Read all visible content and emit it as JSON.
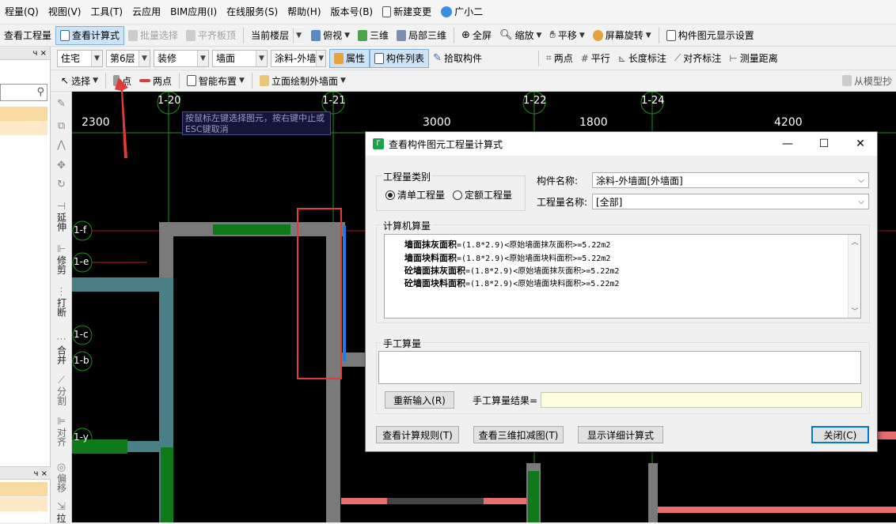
{
  "menubar": {
    "items": [
      "程量(Q)",
      "视图(V)",
      "工具(T)",
      "云应用",
      "BIM应用(I)",
      "在线服务(S)",
      "帮助(H)",
      "版本号(B)"
    ],
    "new_change": "新建变更",
    "assistant": "广小二"
  },
  "toolbar1": {
    "view_quantity": "查看工程量",
    "view_formula": "查看计算式",
    "batch_select": "批量选择",
    "align_slab": "平齐板顶",
    "current_floor": "当前楼层",
    "top_view": "俯视",
    "three_d": "三维",
    "local_3d": "局部三维",
    "fullscreen": "全屏",
    "zoom": "缩放",
    "pan": "平移",
    "rotate": "屏幕旋转",
    "display_settings": "构件图元显示设置"
  },
  "toolbar2": {
    "category": "住宅",
    "floor": "第6层",
    "type": "装修",
    "subtype": "墙面",
    "component": "涂料-外墙",
    "properties": "属性",
    "component_list": "构件列表",
    "pick_component": "拾取构件",
    "two_points": "两点",
    "parallel": "平行",
    "length_dim": "长度标注",
    "aligned_dim": "对齐标注",
    "measure": "测量距离"
  },
  "toolbar3": {
    "select": "选择",
    "point": "点",
    "two_points": "两点",
    "smart_layout": "智能布置",
    "elevation_draw": "立面绘制外墙面",
    "from_model": "从模型抄"
  },
  "left_panel": {
    "pin": "ч ×",
    "pin2": "ч ×"
  },
  "vertical_tools": {
    "extend": "延伸",
    "trim": "修剪",
    "break": "打断",
    "merge": "合并",
    "split": "分割",
    "align": "对齐",
    "offset": "偏移",
    "stretch": "拉"
  },
  "canvas": {
    "tooltip": "按鼠标左键选择图元，按右键中止或ESC键取消",
    "axes_top": [
      "1-20",
      "1-21",
      "1-22",
      "1-24"
    ],
    "dimensions": [
      "2300",
      "3000",
      "1800",
      "4200"
    ],
    "axes_left": [
      "1-f",
      "1-e",
      "1-c",
      "1-b",
      "1-y"
    ]
  },
  "dialog": {
    "title": "查看构件图元工程量计算式",
    "minimize": "—",
    "maximize": "☐",
    "close": "✕",
    "quantity_type_label": "工程量类别",
    "radio_list": "清单工程量",
    "radio_quota": "定额工程量",
    "component_name_label": "构件名称:",
    "component_name_value": "涂料-外墙面[外墙面]",
    "quantity_name_label": "工程量名称:",
    "quantity_name_value": "[全部]",
    "calc_label": "计算机算量",
    "calc_lines": [
      {
        "name": "墙面抹灰面积",
        "formula": "=(1.8*2.9)<原始墙面抹灰面积>=5.22m2"
      },
      {
        "name": "墙面块料面积",
        "formula": "=(1.8*2.9)<原始墙面块料面积>=5.22m2"
      },
      {
        "name": "砼墙面抹灰面积",
        "formula": "=(1.8*2.9)<原始墙面抹灰面积>=5.22m2"
      },
      {
        "name": "砼墙面块料面积",
        "formula": "=(1.8*2.9)<原始墙面块料面积>=5.22m2"
      }
    ],
    "manual_label": "手工算量",
    "reenter_button": "重新输入(R)",
    "manual_result_label": "手工算量结果=",
    "view_rules_button": "查看计算规则(T)",
    "view_3d_button": "查看三维扣减图(T)",
    "show_detail_button": "显示详细计算式",
    "close_button": "关闭(C)"
  },
  "colors": {
    "accent": "#0078d7",
    "annotation": "#e23a3a",
    "canvas_bg": "#000000"
  }
}
